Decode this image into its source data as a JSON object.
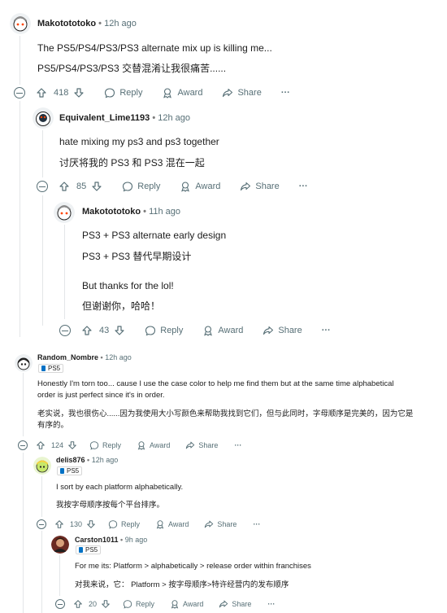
{
  "comments": [
    {
      "username": "Makotototoko",
      "time": "12h ago",
      "lines": [
        "The PS5/PS4/PS3/PS3 alternate mix up is killing me...",
        "PS5/PS4/PS3/PS3 交替混淆让我很痛苦......"
      ],
      "votes": "418",
      "reply_label": "Reply",
      "award_label": "Award",
      "share_label": "Share",
      "more_label": "···"
    },
    {
      "username": "Equivalent_Lime1193",
      "time": "12h ago",
      "lines": [
        "hate mixing my ps3 and ps3 together",
        "讨厌将我的 PS3 和 PS3 混在一起"
      ],
      "votes": "85",
      "reply_label": "Reply",
      "award_label": "Award",
      "share_label": "Share",
      "more_label": "···"
    },
    {
      "username": "Makotototoko",
      "time": "11h ago",
      "lines": [
        "PS3 + PS3 alternate early design",
        "PS3 + PS3 替代早期设计",
        "But thanks for the lol!",
        "但谢谢你，哈哈！"
      ],
      "votes": "43",
      "reply_label": "Reply",
      "award_label": "Award",
      "share_label": "Share",
      "more_label": "···"
    },
    {
      "username": "Random_Nombre",
      "time": "12h ago",
      "flair": "PS5",
      "lines": [
        "Honestly I'm torn too... cause I use the case color to help me find them but at the same time alphabetical",
        "order is just perfect since it's in order.",
        "老实说，我也很伤心......因为我使用大小写颜色来帮助我找到它们，但与此同时，字母顺序是完美的，因为它是",
        "有序的。"
      ],
      "votes": "124",
      "reply_label": "Reply",
      "award_label": "Award",
      "share_label": "Share",
      "more_label": "···"
    },
    {
      "username": "delis876",
      "time": "12h ago",
      "flair": "PS5",
      "lines": [
        "I sort by each platform alphabetically.",
        "我按字母顺序按每个平台排序。"
      ],
      "votes": "130",
      "reply_label": "Reply",
      "award_label": "Award",
      "share_label": "Share",
      "more_label": "···"
    },
    {
      "username": "Carston1011",
      "time": "9h ago",
      "flair": "PS5",
      "lines": [
        "For me its: Platform > alphabetically > release order within franchises",
        "对我来说，它： Platform > 按字母顺序>特许经营内的发布顺序"
      ],
      "votes": "20",
      "reply_label": "Reply",
      "award_label": "Award",
      "share_label": "Share",
      "more_label": "···"
    }
  ],
  "separator": "•",
  "colors": {
    "text": "#1c1c1c",
    "meta": "#576f76",
    "thread_line": "#e3e6e8",
    "flair_icon": "#0071c5"
  },
  "icons": [
    "upvote-icon",
    "downvote-icon",
    "reply-icon",
    "award-icon",
    "share-icon",
    "more-icon",
    "collapse-icon",
    "flair-icon"
  ]
}
